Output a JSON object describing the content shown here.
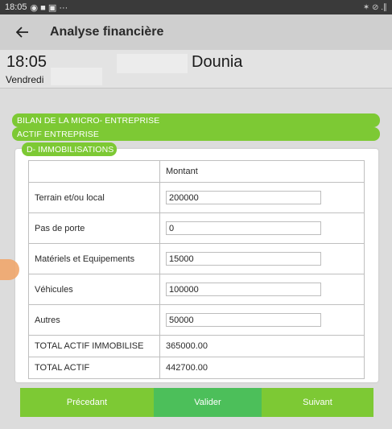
{
  "status_bar": {
    "time": "18:05",
    "left_icons": "◉ ■ ▣  ···",
    "right_icons": "✶ ⊘ .∥"
  },
  "app_bar": {
    "title": "Analyse financière"
  },
  "header": {
    "time": "18:05",
    "username": "Dounia",
    "day": "Vendredi"
  },
  "sections": {
    "bilan": "BILAN DE LA MICRO- ENTREPRISE",
    "actif": "ACTIF ENTREPRISE",
    "immobilisations": "D- IMMOBILISATIONS"
  },
  "table": {
    "header_label": "",
    "header_amount": "Montant",
    "rows": [
      {
        "label": "Terrain et/ou local",
        "value": "200000"
      },
      {
        "label": "Pas de porte",
        "value": "0"
      },
      {
        "label": "Matériels et Equipements",
        "value": "15000"
      },
      {
        "label": "Véhicules",
        "value": "100000"
      },
      {
        "label": "Autres",
        "value": "50000"
      }
    ],
    "totals": [
      {
        "label": "TOTAL ACTIF IMMOBILISE",
        "value": "365000.00"
      },
      {
        "label": "TOTAL ACTIF",
        "value": "442700.00"
      }
    ]
  },
  "buttons": {
    "prev": "Précedant",
    "validate": "Valider",
    "next": "Suivant"
  },
  "colors": {
    "green": "#7dc934",
    "validate_green": "#4cbf5a"
  }
}
